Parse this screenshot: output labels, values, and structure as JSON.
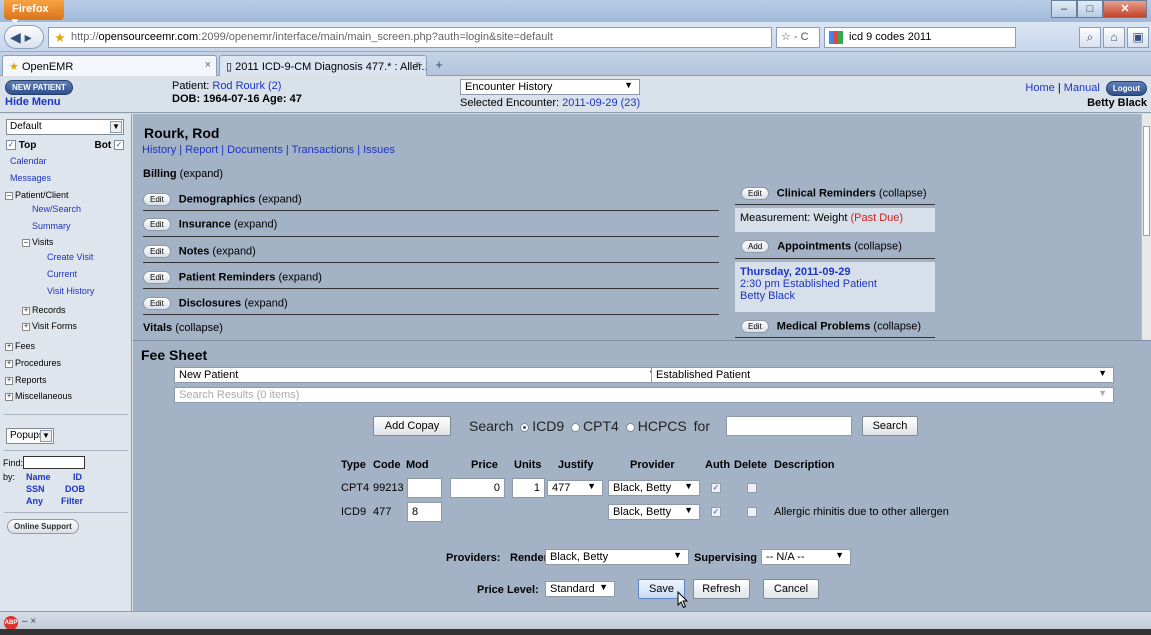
{
  "browser": {
    "menu_button": "Firefox",
    "url_host": "opensourceemr.com",
    "url_rest": ":2099/openemr/interface/main/main_screen.php?auth=login&site=default",
    "url_right": "☆ - C",
    "search_text": "icd 9 codes 2011",
    "tabs": [
      {
        "label": "OpenEMR"
      },
      {
        "label": "2011 ICD-9-CM Diagnosis 477.* : Aller..."
      }
    ]
  },
  "topbar": {
    "new_patient": "NEW PATIENT",
    "hide_menu": "Hide Menu",
    "patient_label": "Patient:",
    "patient_name": "Rod Rourk (2)",
    "dob_line": "DOB: 1964-07-16 Age: 47",
    "encounter_select": "Encounter History",
    "selected_encounter_label": "Selected Encounter:",
    "selected_encounter": "2011-09-29 (23)",
    "home": "Home",
    "manual": "Manual",
    "logout": "Logout",
    "user": "Betty Black"
  },
  "leftnav": {
    "frame_select": "Default",
    "top_label": "Top",
    "bot_label": "Bot",
    "calendar": "Calendar",
    "messages": "Messages",
    "patient_client": "Patient/Client",
    "new_search": "New/Search",
    "summary": "Summary",
    "visits": "Visits",
    "create_visit": "Create Visit",
    "current": "Current",
    "visit_history": "Visit History",
    "records": "Records",
    "visit_forms": "Visit Forms",
    "fees": "Fees",
    "procedures": "Procedures",
    "reports": "Reports",
    "miscellaneous": "Miscellaneous",
    "popups": "Popups",
    "find_label": "Find:",
    "by_label": "by:",
    "find_name": "Name",
    "find_id": "ID",
    "find_ssn": "SSN",
    "find_dob": "DOB",
    "find_any": "Any",
    "find_filter": "Filter",
    "online_support": "Online Support"
  },
  "summary": {
    "name": "Rourk, Rod",
    "links": "History | Report | Documents | Transactions | Issues",
    "billing": "Billing",
    "billing_state": "(expand)",
    "sections": [
      {
        "title": "Demographics",
        "state": "(expand)",
        "button": "Edit"
      },
      {
        "title": "Insurance",
        "state": "(expand)",
        "button": "Edit"
      },
      {
        "title": "Notes",
        "state": "(expand)",
        "button": "Edit"
      },
      {
        "title": "Patient Reminders",
        "state": "(expand)",
        "button": "Edit"
      },
      {
        "title": "Disclosures",
        "state": "(expand)",
        "button": "Edit"
      }
    ],
    "vitals": "Vitals",
    "vitals_state": "(collapse)",
    "clinical_reminders": "Clinical Reminders",
    "clinical_reminders_state": "(collapse)",
    "clinical_button": "Edit",
    "measurement": "Measurement: Weight",
    "past_due": "(Past Due)",
    "appointments": "Appointments",
    "appointments_state": "(collapse)",
    "appointments_button": "Add",
    "appt_date": "Thursday, 2011-09-29",
    "appt_time": "2:30 pm Established Patient",
    "appt_provider": "Betty Black",
    "medical_problems": "Medical Problems",
    "medical_problems_state": "(collapse)",
    "medical_button": "Edit"
  },
  "fee_sheet": {
    "title": "Fee Sheet",
    "select_left": "New Patient",
    "select_right": "Established Patient",
    "search_results": "Search Results (0 items)",
    "add_copay": "Add Copay",
    "search_label": "Search",
    "opt_icd9": "ICD9",
    "opt_cpt4": "CPT4",
    "opt_hcpcs": "HCPCS",
    "for_label": "for",
    "search_button": "Search",
    "columns": {
      "type": "Type",
      "code": "Code",
      "mod": "Mod",
      "price": "Price",
      "units": "Units",
      "justify": "Justify",
      "provider": "Provider",
      "auth": "Auth",
      "delete": "Delete",
      "description": "Description"
    },
    "rows": [
      {
        "type": "CPT4",
        "code": "99213",
        "mod": "",
        "price": "0",
        "units": "1",
        "justify": "477",
        "provider": "Black, Betty",
        "description": ""
      },
      {
        "type": "ICD9",
        "code": "477",
        "mod": "8",
        "price": "",
        "units": "",
        "justify": "",
        "provider": "Black, Betty",
        "description": "Allergic rhinitis due to other allergen"
      }
    ],
    "providers_label": "Providers:",
    "rendering_label": "Rendering",
    "rendering_value": "Black, Betty",
    "supervising_label": "Supervising",
    "supervising_value": "-- N/A --",
    "price_level_label": "Price Level:",
    "price_level_value": "Standard",
    "save": "Save",
    "refresh": "Refresh",
    "cancel": "Cancel"
  }
}
